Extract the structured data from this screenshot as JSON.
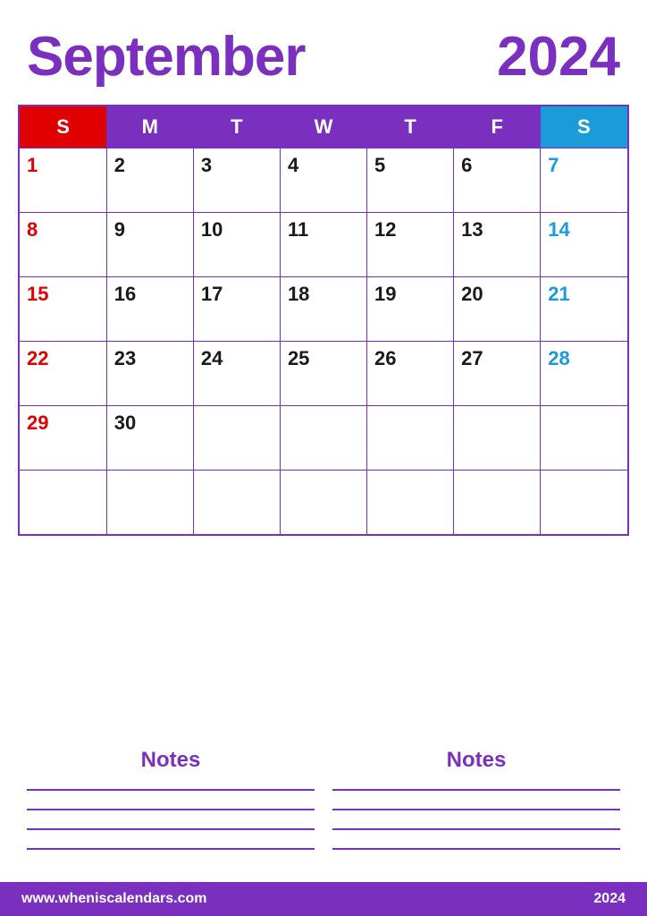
{
  "header": {
    "month": "September",
    "year": "2024"
  },
  "calendar": {
    "days_of_week": [
      "S",
      "M",
      "T",
      "W",
      "T",
      "F",
      "S"
    ],
    "weeks": [
      [
        "1",
        "2",
        "3",
        "4",
        "5",
        "6",
        "7"
      ],
      [
        "8",
        "9",
        "10",
        "11",
        "12",
        "13",
        "14"
      ],
      [
        "15",
        "16",
        "17",
        "18",
        "19",
        "20",
        "21"
      ],
      [
        "22",
        "23",
        "24",
        "25",
        "26",
        "27",
        "28"
      ],
      [
        "29",
        "30",
        "",
        "",
        "",
        "",
        ""
      ],
      [
        "",
        "",
        "",
        "",
        "",
        "",
        ""
      ]
    ]
  },
  "notes": {
    "label": "Notes",
    "lines": 4
  },
  "footer": {
    "url": "www.wheniscalendars.com",
    "year": "2024"
  }
}
